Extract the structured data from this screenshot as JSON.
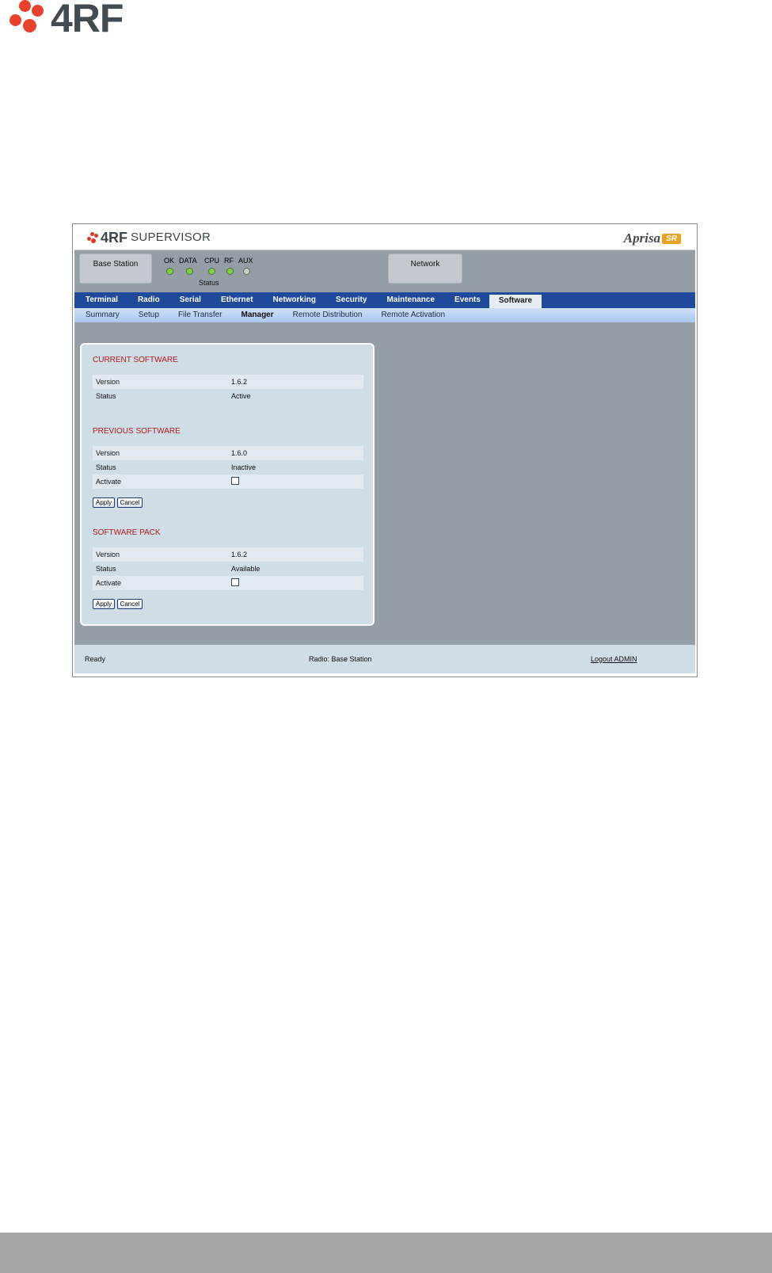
{
  "page": {
    "logo_text": "4RF"
  },
  "app": {
    "brand": "4RF",
    "product": "SUPERVISOR",
    "model": "Aprisa",
    "model_badge": "SR"
  },
  "status_panel": {
    "terminal_label": "Base Station",
    "network_label": "Network",
    "leds": [
      {
        "label": "OK",
        "color": "#7dd43a"
      },
      {
        "label": "DATA",
        "color": "#7dd43a"
      },
      {
        "label": "CPU",
        "color": "#7dd43a"
      },
      {
        "label": "RF",
        "color": "#7dd43a"
      },
      {
        "label": "AUX",
        "color": "#c8cdd0"
      }
    ],
    "status_label": "Status"
  },
  "nav": {
    "items": [
      "Terminal",
      "Radio",
      "Serial",
      "Ethernet",
      "Networking",
      "Security",
      "Maintenance",
      "Events",
      "Software"
    ],
    "active": "Software"
  },
  "subnav": {
    "items": [
      "Summary",
      "Setup",
      "File Transfer",
      "Manager",
      "Remote Distribution",
      "Remote Activation"
    ],
    "active": "Manager"
  },
  "current_software": {
    "title": "CURRENT SOFTWARE",
    "version_label": "Version",
    "version": "1.6.2",
    "status_label": "Status",
    "status": "Active"
  },
  "previous_software": {
    "title": "PREVIOUS SOFTWARE",
    "version_label": "Version",
    "version": "1.6.0",
    "status_label": "Status",
    "status": "Inactive",
    "activate_label": "Activate",
    "apply_label": "Apply",
    "cancel_label": "Cancel"
  },
  "software_pack": {
    "title": "SOFTWARE PACK",
    "version_label": "Version",
    "version": "1.6.2",
    "status_label": "Status",
    "status": "Available",
    "activate_label": "Activate",
    "apply_label": "Apply",
    "cancel_label": "Cancel"
  },
  "footer": {
    "ready": "Ready",
    "radio": "Radio: Base Station",
    "logout": "Logout ADMIN"
  },
  "colors": {
    "accent_red": "#e8412c",
    "nav_blue": "#1f4a9b",
    "section_red": "#b31b1b",
    "panel_gray": "#939ea6"
  }
}
